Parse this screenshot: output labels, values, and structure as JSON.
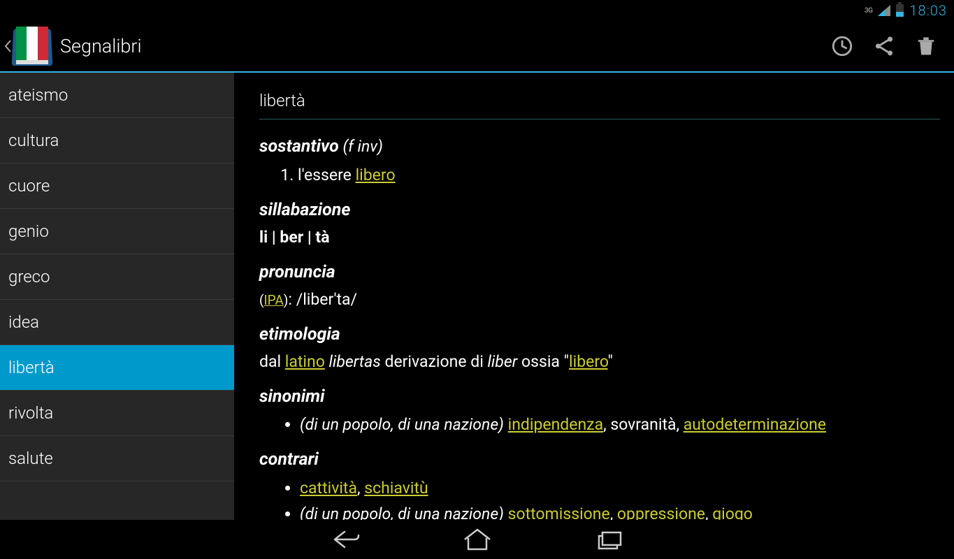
{
  "status": {
    "network": "3G",
    "time": "18:03"
  },
  "actionbar": {
    "title": "Segnalibri"
  },
  "sidebar": {
    "items": [
      {
        "label": "ateismo"
      },
      {
        "label": "cultura"
      },
      {
        "label": "cuore"
      },
      {
        "label": "genio"
      },
      {
        "label": "greco"
      },
      {
        "label": "idea"
      },
      {
        "label": "libertà",
        "selected": true
      },
      {
        "label": "rivolta"
      },
      {
        "label": "salute"
      }
    ]
  },
  "entry": {
    "headword": "libertà",
    "pos_label": "sostantivo",
    "pos_gram": "(f inv)",
    "def1_prefix": "l'essere ",
    "def1_link": "libero",
    "sec_sill": "sillabazione",
    "syllab": "li | ber | tà",
    "sec_pron": "pronuncia",
    "ipa_label": "IPA",
    "ipa_value": "/liber'ta/",
    "sec_etym": "etimologia",
    "etym_t1": "dal ",
    "etym_link1": "latino",
    "etym_t2": " libertas",
    "etym_t3": " derivazione di ",
    "etym_t4": "liber",
    "etym_t5": " ossia \"",
    "etym_link2": "libero",
    "etym_t6": "\"",
    "sec_syn": "sinonimi",
    "syn_context": "(di un popolo, di una nazione)",
    "syn_link1": "indipendenza",
    "syn_t1": ", sovranità, ",
    "syn_link2": "autodeterminazione",
    "sec_ant": "contrari",
    "ant_link1": "cattività",
    "ant_sep": ", ",
    "ant_link2": "schiavitù",
    "ant2_context": "(di un popolo, di una nazione)",
    "ant2_link1": "sottomissione",
    "ant2_t1": ", ",
    "ant2_link2": "oppressione",
    "ant2_t2": ", ",
    "ant2_link3": "giogo"
  }
}
